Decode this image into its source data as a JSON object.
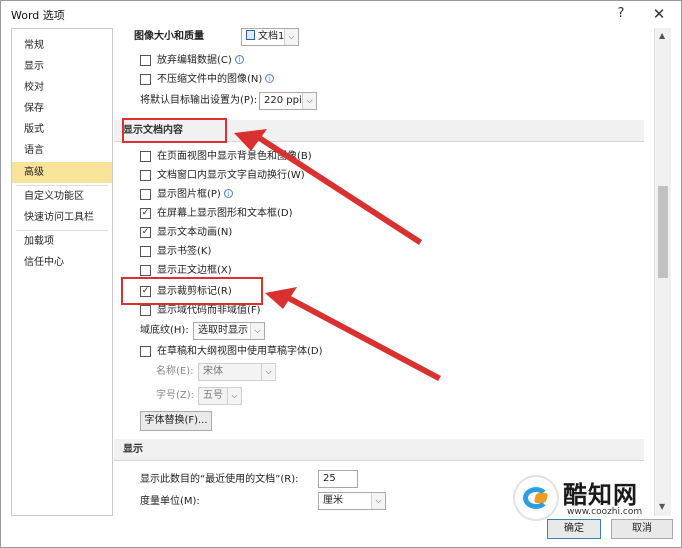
{
  "window": {
    "title": "Word 选项",
    "help_glyph": "?",
    "close_glyph": "✕"
  },
  "sidebar": {
    "items": [
      {
        "label": "常规"
      },
      {
        "label": "显示"
      },
      {
        "label": "校对"
      },
      {
        "label": "保存"
      },
      {
        "label": "版式"
      },
      {
        "label": "语言"
      },
      {
        "label": "高级",
        "selected": true
      },
      {
        "label": "自定义功能区"
      },
      {
        "label": "快速访问工具栏"
      },
      {
        "label": "加载项"
      },
      {
        "label": "信任中心"
      }
    ]
  },
  "image_size": {
    "header_label": "图像大小和质量",
    "doc_combo_value": "文档1",
    "discard_edit_data": {
      "label": "放弃编辑数据(C)",
      "checked": false
    },
    "no_compress": {
      "label": "不压缩文件中的图像(N)",
      "checked": false
    },
    "default_target_label": "将默认目标输出设置为(P):",
    "default_target_value": "220 ppi"
  },
  "show_doc_content": {
    "header": "显示文档内容",
    "items": [
      {
        "label": "在页面视图中显示背景色和图像(B)",
        "checked": false
      },
      {
        "label": "文档窗口内显示文字自动换行(W)",
        "checked": false
      },
      {
        "label": "显示图片框(P)",
        "checked": false,
        "info": true
      },
      {
        "label": "在屏幕上显示图形和文本框(D)",
        "checked": true
      },
      {
        "label": "显示文本动画(N)",
        "checked": true
      },
      {
        "label": "显示书签(K)",
        "checked": false
      },
      {
        "label": "显示正文边框(X)",
        "checked": false
      },
      {
        "label": "显示裁剪标记(R)",
        "checked": true
      },
      {
        "label": "显示域代码而非域值(F)",
        "checked": false
      }
    ],
    "field_shading_label": "域底纹(H):",
    "field_shading_value": "选取时显示",
    "draft_font": {
      "label": "在草稿和大纲视图中使用草稿字体(D)",
      "checked": false
    },
    "name_label": "名称(E):",
    "name_value": "宋体",
    "size_label": "字号(Z):",
    "size_value": "五号",
    "font_substitution_button": "字体替换(F)..."
  },
  "display": {
    "header": "显示",
    "recent_docs_label": "显示此数目的“最近使用的文档”(R):",
    "recent_docs_value": "25",
    "units_label": "度量单位(M):",
    "units_value": "厘米"
  },
  "footer": {
    "ok_label": "确定",
    "cancel_label": "取消"
  },
  "watermark": {
    "name": "酷知网",
    "url": "www.coozhi.com"
  },
  "annotation_color": "#d93030",
  "selection_color": "#f8e39a",
  "check_glyph": "✓",
  "info_glyph": "i",
  "dropdown_glyph": "⌵"
}
